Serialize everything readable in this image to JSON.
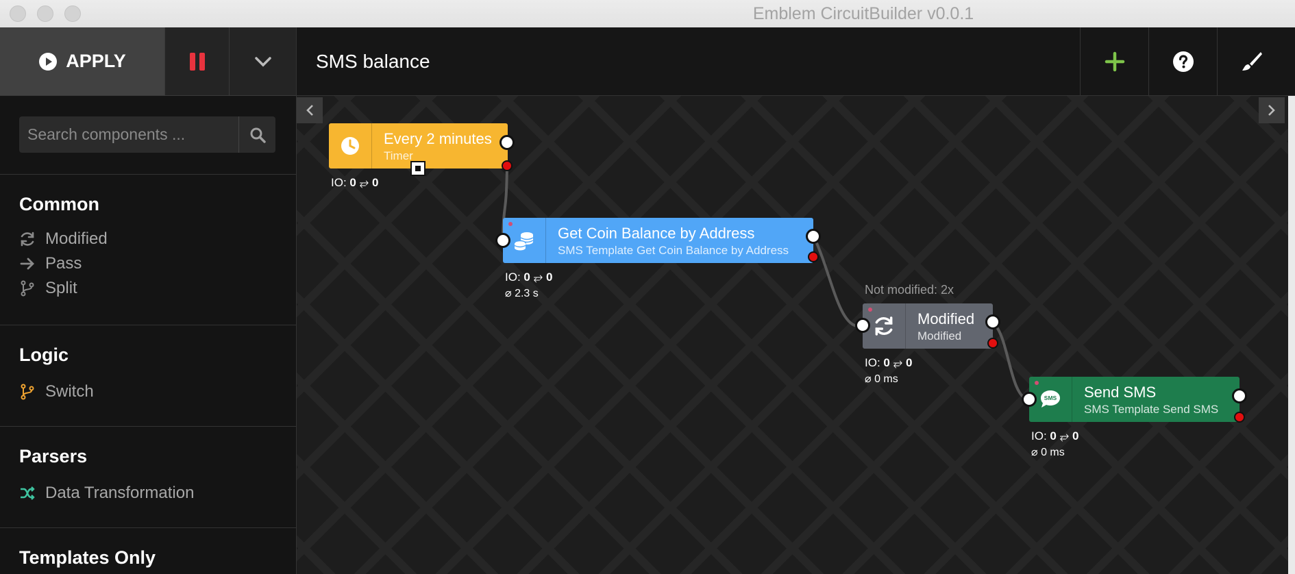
{
  "window": {
    "title": "Emblem CircuitBuilder v0.0.1"
  },
  "toolbar": {
    "apply_label": "APPLY"
  },
  "header": {
    "flow_title": "SMS balance"
  },
  "search": {
    "placeholder": "Search components ..."
  },
  "sidebar": {
    "sections": [
      {
        "title": "Common",
        "items": [
          "Modified",
          "Pass",
          "Split"
        ]
      },
      {
        "title": "Logic",
        "items": [
          "Switch"
        ]
      },
      {
        "title": "Parsers",
        "items": [
          "Data Transformation"
        ]
      },
      {
        "title": "Templates Only",
        "items": []
      }
    ]
  },
  "nodes": {
    "timer": {
      "title": "Every 2 minutes",
      "subtitle": "Timer",
      "io_in": "0",
      "io_out": "0",
      "color": "#f7b630"
    },
    "coin": {
      "title": "Get Coin Balance by Address",
      "subtitle": "SMS Template Get Coin Balance by Address",
      "io_in": "0",
      "io_out": "0",
      "stat": "⌀ 2.3 s",
      "color": "#51a6f7"
    },
    "modified": {
      "title": "Modified",
      "subtitle": "Modified",
      "io_in": "0",
      "io_out": "0",
      "stat": "⌀ 0 ms",
      "note": "Not modified: 2x",
      "color": "#62666f"
    },
    "sms": {
      "title": "Send SMS",
      "subtitle": "SMS Template Send SMS",
      "io_in": "0",
      "io_out": "0",
      "stat": "⌀ 0 ms",
      "color": "#1e7d4d"
    }
  },
  "io": {
    "prefix": "IO:",
    "arrow": "⥂"
  },
  "icons": {
    "apply": "play-circle-icon",
    "pause": "pause-icon",
    "menu": "chevron-down-icon",
    "add": "plus-icon",
    "help": "help-circle-icon",
    "theme": "paintbrush-icon"
  },
  "colors": {
    "add_icon": "#7ec44a",
    "pause": "#e8333e",
    "switch_icon": "#f0a431",
    "transform_icon": "#3fc4a0"
  }
}
